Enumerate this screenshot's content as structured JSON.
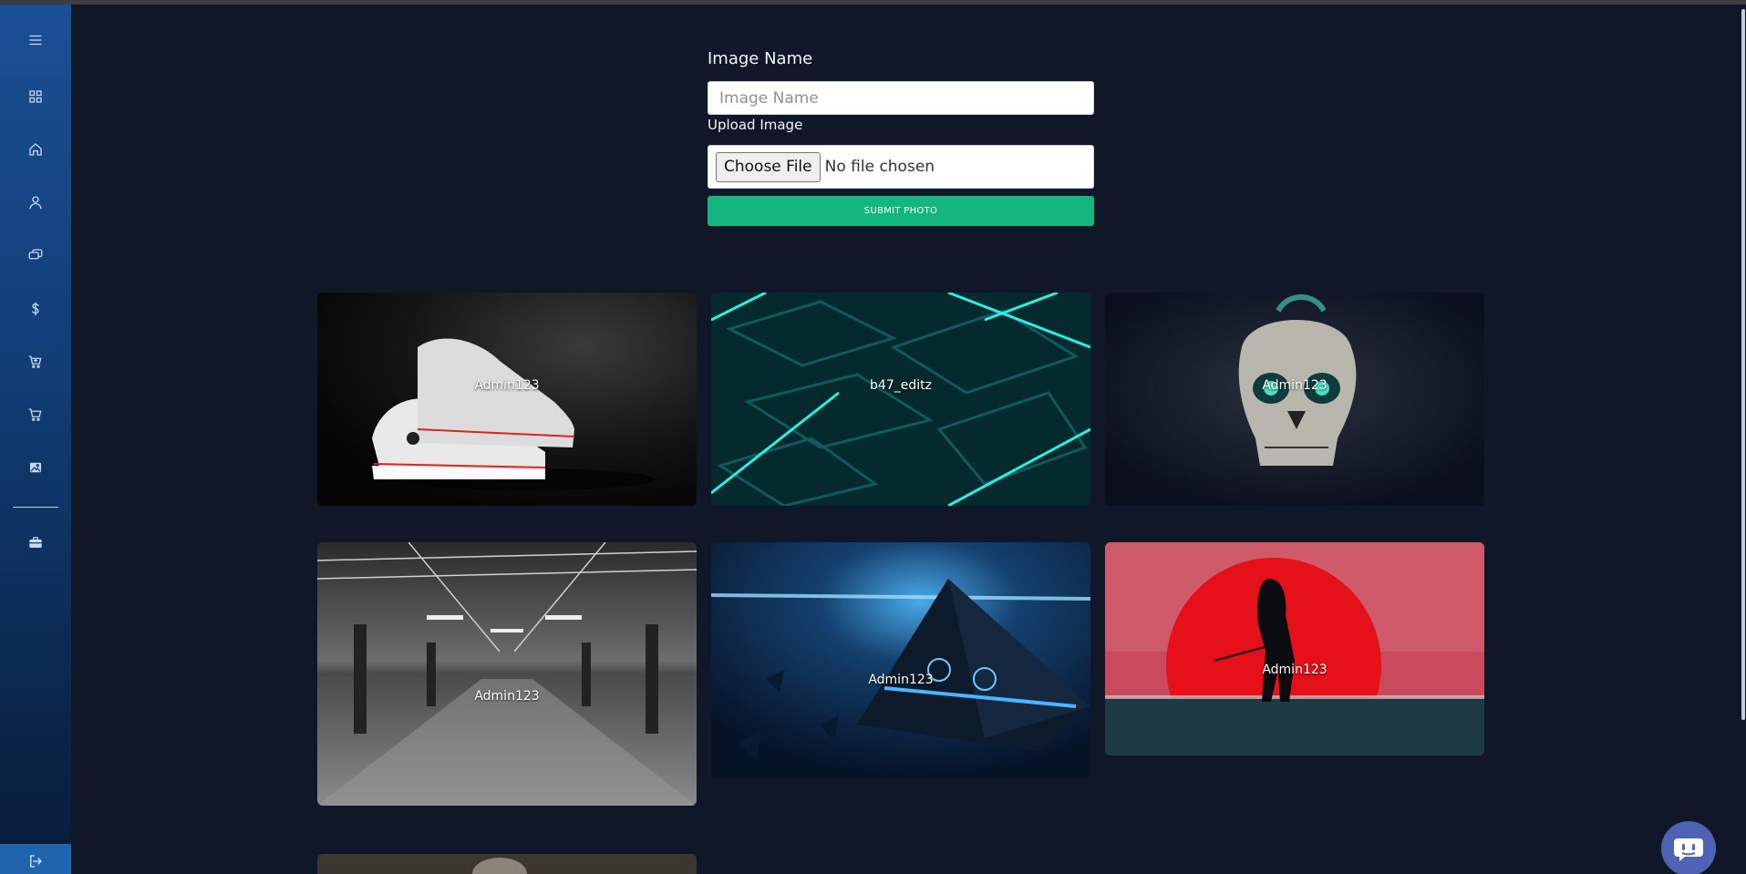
{
  "sidebar": {
    "items": [
      {
        "icon": "menu-icon"
      },
      {
        "icon": "dashboard-icon"
      },
      {
        "icon": "home-icon"
      },
      {
        "icon": "user-icon"
      },
      {
        "icon": "chat-icon"
      },
      {
        "icon": "dollar-icon"
      },
      {
        "icon": "cart-add-icon"
      },
      {
        "icon": "cart-icon"
      },
      {
        "icon": "image-icon"
      },
      {
        "icon": "briefcase-icon"
      }
    ],
    "logout_icon": "logout-icon"
  },
  "form": {
    "name_label": "Image Name",
    "name_placeholder": "Image Name",
    "upload_label": "Upload Image",
    "choose_file_label": "Choose File",
    "no_file_text": "No file chosen",
    "submit_label": "SUBMIT PHOTO"
  },
  "gallery": [
    {
      "author": "Admin123",
      "theme": "white sneakers on dark background"
    },
    {
      "author": "b47_editz",
      "theme": "neon cyan maze"
    },
    {
      "author": "Admin123",
      "theme": "skull with glowing eyes"
    },
    {
      "author": "Admin123",
      "theme": "black and white gym interior"
    },
    {
      "author": "Admin123",
      "theme": "blue glowing pyramid"
    },
    {
      "author": "Admin123",
      "theme": "silhouette against red sun"
    },
    {
      "author": "",
      "theme": "partially visible image"
    }
  ],
  "colors": {
    "background": "#101728",
    "sidebar": "#1a4f94",
    "submit": "#14b680",
    "chat_button": "#4f63b4"
  },
  "chat_icon": "chatbot-icon"
}
